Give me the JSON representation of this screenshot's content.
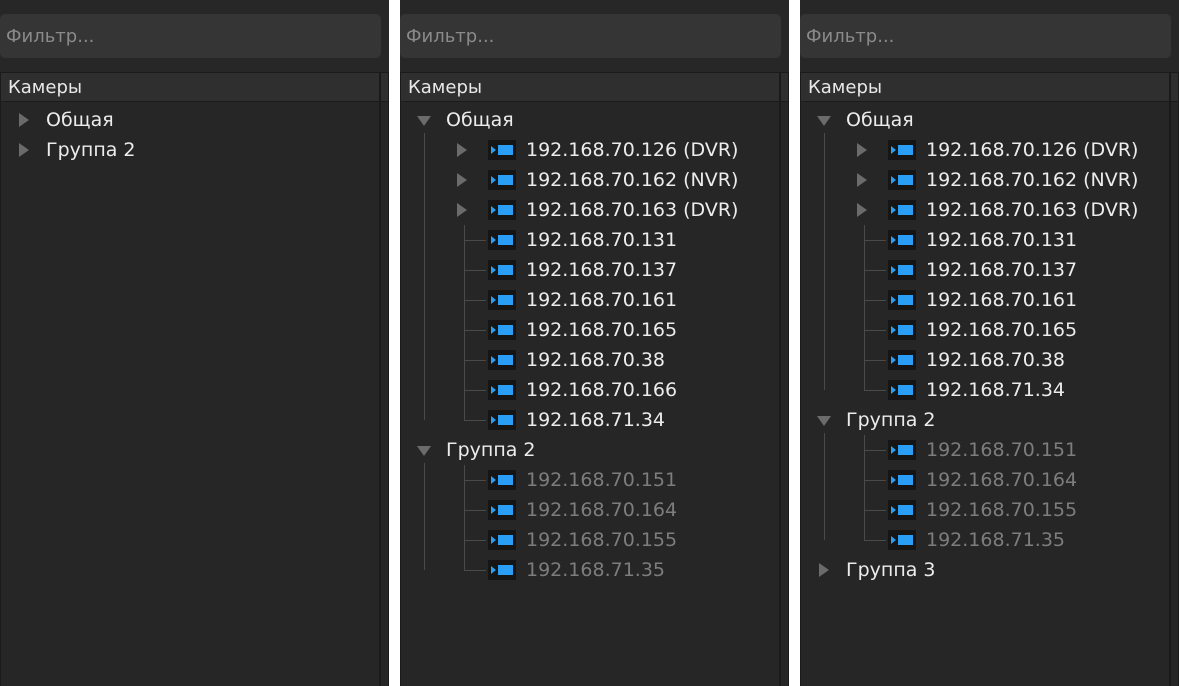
{
  "filter_placeholder": "Фильтр...",
  "tree_header": "Камеры",
  "panels": [
    {
      "groups": [
        {
          "label": "Общая",
          "expanded": false
        },
        {
          "label": "Группа 2",
          "expanded": false
        }
      ]
    },
    {
      "groups": [
        {
          "label": "Общая",
          "expanded": true,
          "devices": [
            "192.168.70.126 (DVR)",
            "192.168.70.162 (NVR)",
            "192.168.70.163 (DVR)"
          ],
          "cameras": [
            "192.168.70.131",
            "192.168.70.137",
            "192.168.70.161",
            "192.168.70.165",
            "192.168.70.38",
            "192.168.70.166",
            "192.168.71.34"
          ]
        },
        {
          "label": "Группа 2",
          "expanded": true,
          "cameras_offline": [
            "192.168.70.151",
            "192.168.70.164",
            "192.168.70.155",
            "192.168.71.35"
          ]
        }
      ]
    },
    {
      "groups": [
        {
          "label": "Общая",
          "expanded": true,
          "devices": [
            "192.168.70.126 (DVR)",
            "192.168.70.162 (NVR)",
            "192.168.70.163 (DVR)"
          ],
          "cameras": [
            "192.168.70.131",
            "192.168.70.137",
            "192.168.70.161",
            "192.168.70.165",
            "192.168.70.38",
            "192.168.71.34"
          ]
        },
        {
          "label": "Группа 2",
          "expanded": true,
          "cameras_offline": [
            "192.168.70.151",
            "192.168.70.164",
            "192.168.70.155",
            "192.168.71.35"
          ]
        },
        {
          "label": "Группа 3",
          "expanded": false
        }
      ]
    }
  ],
  "colors": {
    "camera_icon": "#2a9df4",
    "text": "#ececec",
    "offline_text": "#7d7d7d",
    "background": "#272727"
  },
  "icons": {
    "camera": "camera-icon",
    "collapsed": "triangle-right-icon",
    "expanded": "triangle-down-icon"
  }
}
